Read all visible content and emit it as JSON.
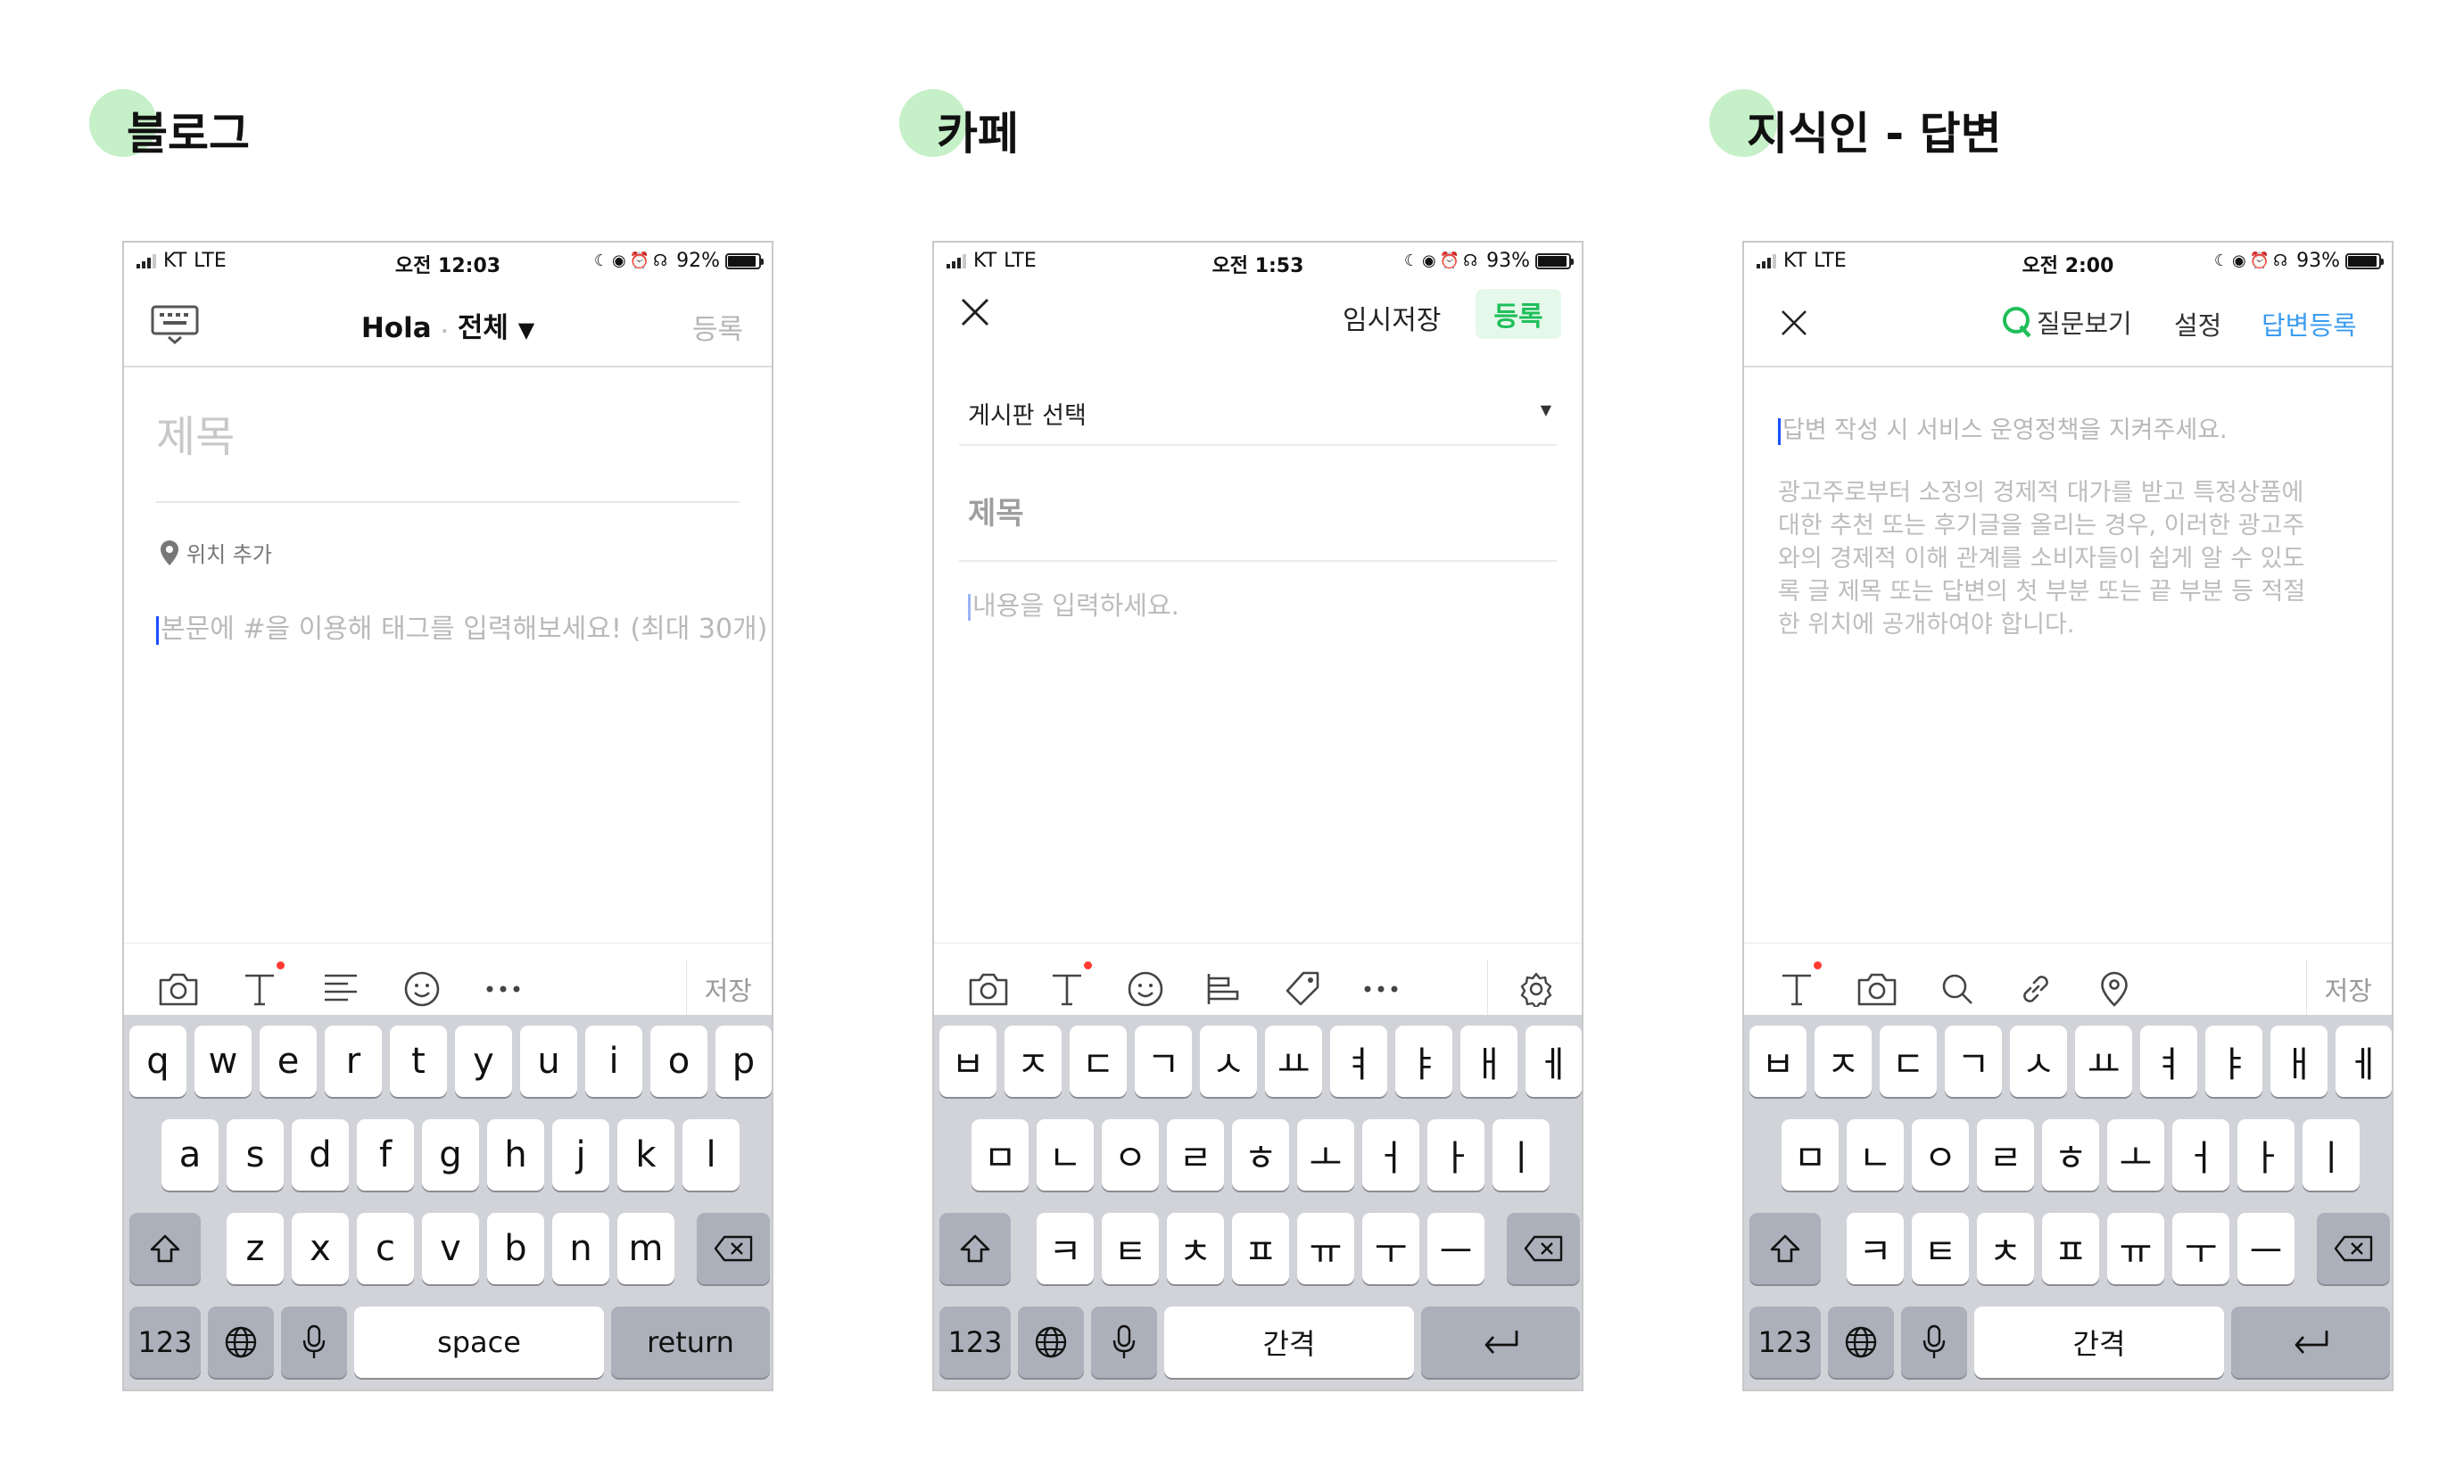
{
  "sections": [
    {
      "title": "블로그",
      "status": {
        "carrier": "KT",
        "network": "LTE",
        "time": "오전 12:03",
        "battery": "92%",
        "battery_level": 0.92
      },
      "nav": {
        "blog_name": "Hola",
        "category": "전체",
        "submit": "등록"
      },
      "title_placeholder": "제목",
      "location": "위치 추가",
      "body_placeholder": "본문에 #을 이용해 태그를 입력해보세요! (최대 30개)",
      "toolbar": {
        "save": "저장",
        "icons": [
          "camera-icon",
          "text-style-icon",
          "align-icon",
          "emoji-icon",
          "more-icon"
        ]
      },
      "keyboard": {
        "rows": [
          [
            "q",
            "w",
            "e",
            "r",
            "t",
            "y",
            "u",
            "i",
            "o",
            "p"
          ],
          [
            "a",
            "s",
            "d",
            "f",
            "g",
            "h",
            "j",
            "k",
            "l"
          ],
          [
            "z",
            "x",
            "c",
            "v",
            "b",
            "n",
            "m"
          ]
        ],
        "numbers": "123",
        "space": "space",
        "return": "return"
      }
    },
    {
      "title": "카페",
      "status": {
        "carrier": "KT",
        "network": "LTE",
        "time": "오전 1:53",
        "battery": "93%",
        "battery_level": 0.93
      },
      "nav": {
        "temp_save": "임시저장",
        "submit": "등록"
      },
      "board_select": "게시판 선택",
      "title_placeholder": "제목",
      "body_placeholder": "내용을 입력하세요.",
      "toolbar": {
        "icons": [
          "camera-icon",
          "text-style-icon",
          "emoji-icon",
          "align-icon",
          "tag-icon",
          "more-icon",
          "gear-icon"
        ]
      },
      "keyboard": {
        "rows": [
          [
            "ㅂ",
            "ㅈ",
            "ㄷ",
            "ㄱ",
            "ㅅ",
            "ㅛ",
            "ㅕ",
            "ㅑ",
            "ㅐ",
            "ㅔ"
          ],
          [
            "ㅁ",
            "ㄴ",
            "ㅇ",
            "ㄹ",
            "ㅎ",
            "ㅗ",
            "ㅓ",
            "ㅏ",
            "ㅣ"
          ],
          [
            "ㅋ",
            "ㅌ",
            "ㅊ",
            "ㅍ",
            "ㅠ",
            "ㅜ",
            "ㅡ"
          ]
        ],
        "numbers": "123",
        "space": "간격"
      }
    },
    {
      "title": "지식인 - 답변",
      "status": {
        "carrier": "KT",
        "network": "LTE",
        "time": "오전 2:00",
        "battery": "93%",
        "battery_level": 0.93
      },
      "nav": {
        "view_question": "질문보기",
        "settings": "설정",
        "submit_answer": "답변등록"
      },
      "body_placeholder": "답변 작성 시 서비스 운영정책을 지켜주세요.",
      "notice": [
        "광고주로부터 소정의 경제적 대가를 받고 특정상품에",
        "대한 추천 또는 후기글을 올리는 경우, 이러한 광고주",
        "와의 경제적 이해 관계를 소비자들이 쉽게 알 수 있도",
        "록 글 제목 또는 답변의 첫 부분 또는 끝 부분 등 적절",
        "한 위치에 공개하여야 합니다."
      ],
      "toolbar": {
        "save": "저장",
        "icons": [
          "text-style-icon",
          "camera-icon",
          "search-icon",
          "link-icon",
          "location-pin-icon"
        ]
      },
      "keyboard": {
        "rows": [
          [
            "ㅂ",
            "ㅈ",
            "ㄷ",
            "ㄱ",
            "ㅅ",
            "ㅛ",
            "ㅕ",
            "ㅑ",
            "ㅐ",
            "ㅔ"
          ],
          [
            "ㅁ",
            "ㄴ",
            "ㅇ",
            "ㄹ",
            "ㅎ",
            "ㅗ",
            "ㅓ",
            "ㅏ",
            "ㅣ"
          ],
          [
            "ㅋ",
            "ㅌ",
            "ㅊ",
            "ㅍ",
            "ㅠ",
            "ㅜ",
            "ㅡ"
          ]
        ],
        "numbers": "123",
        "space": "간격"
      }
    }
  ],
  "colors": {
    "accent_green": "#1fbf5a",
    "accent_blue": "#3b9cf0",
    "title_dot": "#c6f0c8",
    "keyboard_bg": "#d1d3d9"
  }
}
